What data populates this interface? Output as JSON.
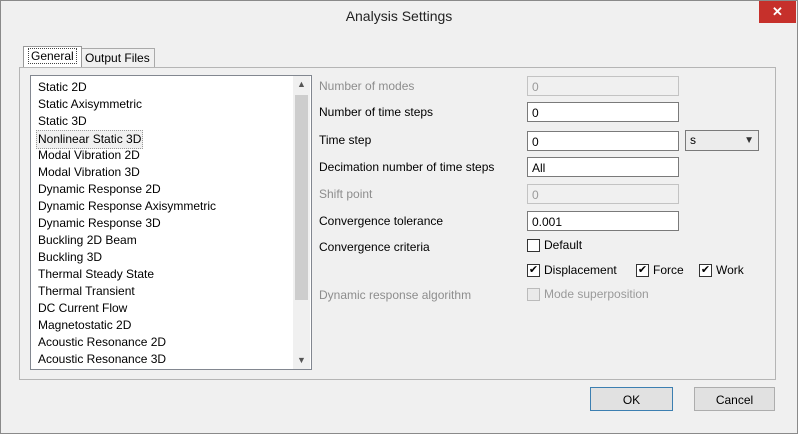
{
  "window": {
    "title": "Analysis Settings",
    "close_glyph": "✕"
  },
  "tabs": [
    {
      "label": "General"
    },
    {
      "label": "Output Files"
    }
  ],
  "analysis_types": [
    "Static 2D",
    "Static Axisymmetric",
    "Static 3D",
    "Nonlinear Static 3D",
    "Modal Vibration 2D",
    "Modal Vibration 3D",
    "Dynamic Response 2D",
    "Dynamic Response Axisymmetric",
    "Dynamic Response 3D",
    "Buckling 2D Beam",
    "Buckling 3D",
    "Thermal Steady State",
    "Thermal Transient",
    "DC Current Flow",
    "Magnetostatic 2D",
    "Acoustic Resonance 2D",
    "Acoustic Resonance 3D"
  ],
  "selected_index": 3,
  "fields": {
    "number_of_modes": {
      "label": "Number of modes",
      "value": "0"
    },
    "number_of_time_steps": {
      "label": "Number of time steps",
      "value": "0"
    },
    "time_step": {
      "label": "Time step",
      "value": "0",
      "unit": "s"
    },
    "decimation": {
      "label": "Decimation number of time steps",
      "value": "All"
    },
    "shift_point": {
      "label": "Shift point",
      "value": "0"
    },
    "convergence_tolerance": {
      "label": "Convergence tolerance",
      "value": "0.001"
    },
    "convergence_criteria": {
      "label": "Convergence criteria"
    },
    "dynamic_response_algorithm": {
      "label": "Dynamic response algorithm"
    }
  },
  "checkboxes": {
    "default": {
      "label": "Default",
      "checked": false
    },
    "displacement": {
      "label": "Displacement",
      "checked": true
    },
    "force": {
      "label": "Force",
      "checked": true
    },
    "work": {
      "label": "Work",
      "checked": true
    },
    "mode_superposition": {
      "label": "Mode superposition",
      "checked": false
    }
  },
  "buttons": {
    "ok": "OK",
    "cancel": "Cancel"
  },
  "check_glyph": "✔",
  "icons": {
    "close": "close-icon",
    "dropdown": "chevron-down-icon",
    "scroll_up": "scroll-up-icon",
    "scroll_down": "scroll-down-icon"
  }
}
